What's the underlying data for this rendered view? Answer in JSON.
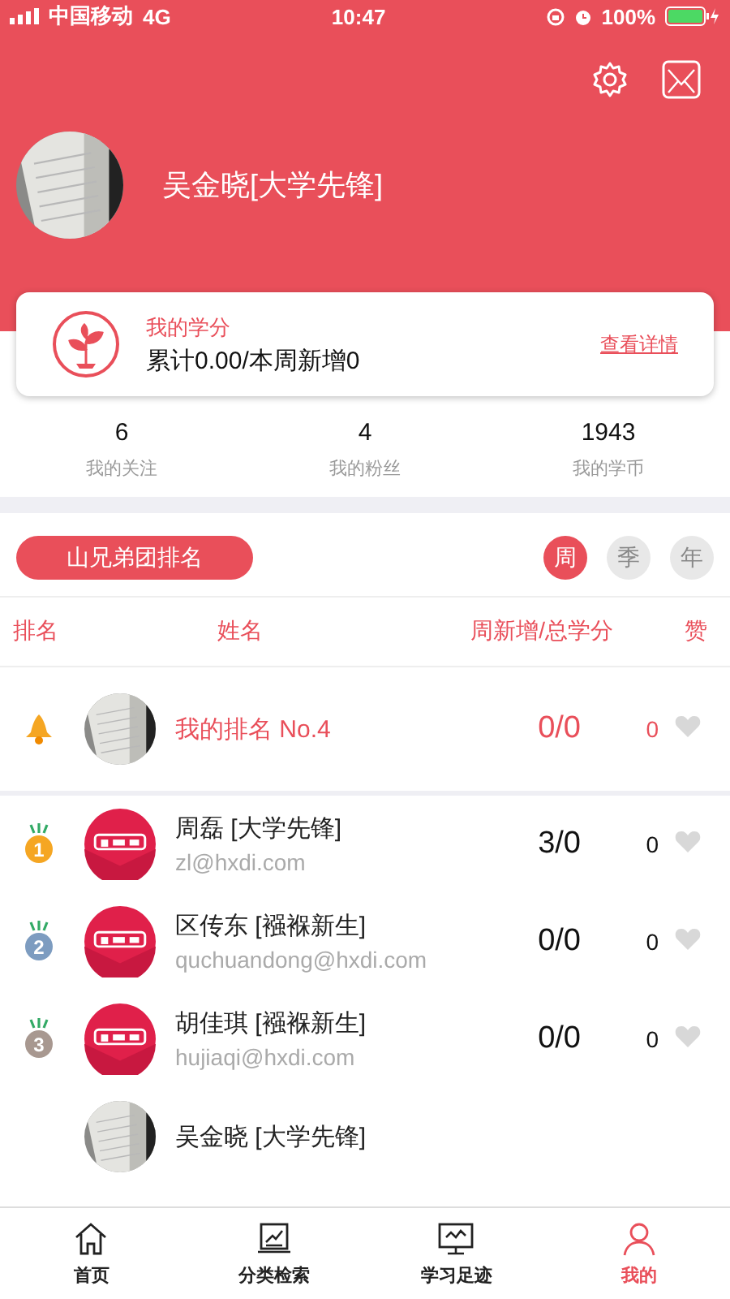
{
  "status_bar": {
    "carrier": "中国移动",
    "network": "4G",
    "time": "10:47",
    "battery": "100%"
  },
  "profile": {
    "name": "吴金晓[大学先锋]"
  },
  "credit_card": {
    "title": "我的学分",
    "summary": "累计0.00/本周新增0",
    "link": "查看详情"
  },
  "stats": [
    {
      "value": "6",
      "label": "我的关注"
    },
    {
      "value": "4",
      "label": "我的粉丝"
    },
    {
      "value": "1943",
      "label": "我的学币"
    }
  ],
  "ranking": {
    "team_button": "山兄弟团排名",
    "periods": [
      {
        "label": "周",
        "selected": true
      },
      {
        "label": "季",
        "selected": false
      },
      {
        "label": "年",
        "selected": false
      }
    ],
    "columns": [
      "排名",
      "姓名",
      "周新增/总学分",
      "赞"
    ],
    "rows": [
      {
        "kind": "self",
        "name": "我的排名 No.4",
        "score": "0/0",
        "likes": "0",
        "liked": false
      },
      {
        "kind": "member",
        "rank": "1",
        "color": "#f5a623",
        "name": "周磊 [大学先锋]",
        "email": "zl@hxdi.com",
        "avatar": {
          "kind": "logo"
        },
        "score": "3/0",
        "likes": "0",
        "liked": false
      },
      {
        "kind": "member",
        "rank": "2",
        "color": "#7d9cc0",
        "name": "区传东 [襁褓新生]",
        "email": "quchuandong@hxdi.com",
        "avatar": {
          "kind": "logo"
        },
        "score": "0/0",
        "likes": "0",
        "liked": false
      },
      {
        "kind": "member",
        "rank": "3",
        "color": "#a89890",
        "name": "胡佳琪 [襁褓新生]",
        "email": "hujiaqi@hxdi.com",
        "avatar": {
          "kind": "logo"
        },
        "score": "0/0",
        "likes": "0",
        "liked": false
      },
      {
        "kind": "member",
        "name": "吴金晓 [大学先锋]"
      }
    ]
  },
  "tab_bar": [
    {
      "kind": "home",
      "label": "首页",
      "selected": false
    },
    {
      "kind": "chart",
      "label": "分类检索",
      "selected": false
    },
    {
      "kind": "monitor",
      "label": "学习足迹",
      "selected": false
    },
    {
      "kind": "person",
      "label": "我的",
      "selected": true
    }
  ]
}
